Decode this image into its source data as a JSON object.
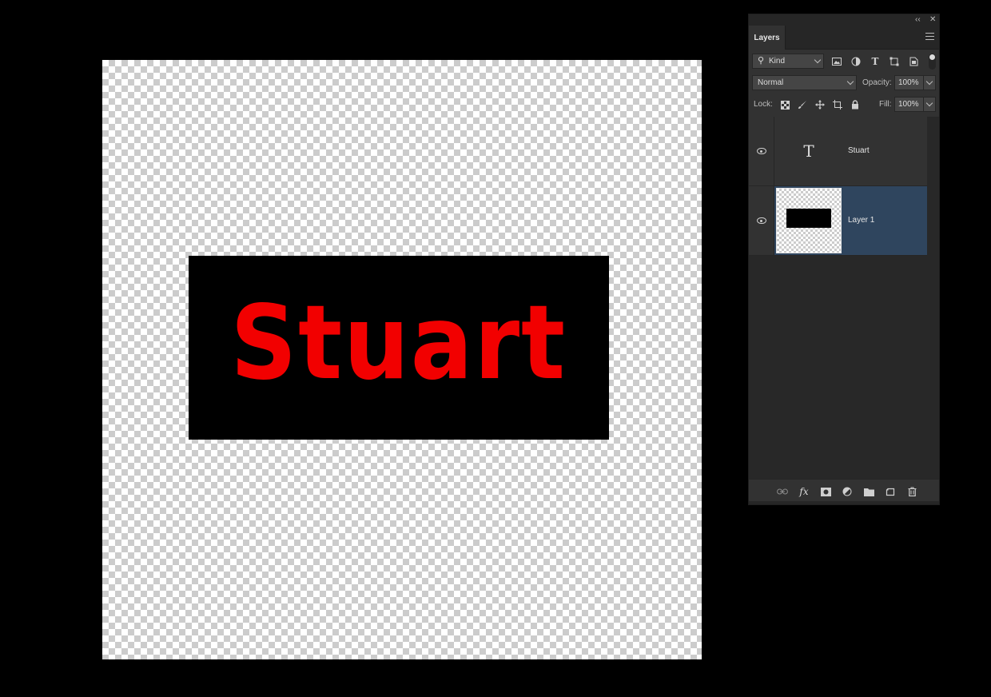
{
  "canvas": {
    "text": "Stuart",
    "text_color": "#f20000",
    "box_color": "#000000"
  },
  "panel": {
    "tab_label": "Layers",
    "collapse_glyph": "‹‹",
    "close_glyph": "✕",
    "filter": {
      "kind_label": "Kind",
      "icons": [
        "image-filter-icon",
        "adjustment-filter-icon",
        "type-filter-icon",
        "shape-filter-icon",
        "smart-object-filter-icon"
      ]
    },
    "blend": {
      "mode": "Normal",
      "opacity_label": "Opacity:",
      "opacity_value": "100%"
    },
    "lock": {
      "label": "Lock:",
      "fill_label": "Fill:",
      "fill_value": "100%"
    },
    "layers": [
      {
        "name": "Stuart",
        "type": "text",
        "glyph": "T",
        "selected": false,
        "visible": true
      },
      {
        "name": "Layer 1",
        "type": "pixel",
        "selected": true,
        "visible": true
      }
    ],
    "bottom_icons": [
      "link-layers-icon",
      "fx-icon",
      "layer-mask-icon",
      "adjustment-layer-icon",
      "new-group-icon",
      "new-layer-icon",
      "delete-layer-icon"
    ],
    "fx_label": "fx",
    "selected_color": "#2f455e"
  }
}
